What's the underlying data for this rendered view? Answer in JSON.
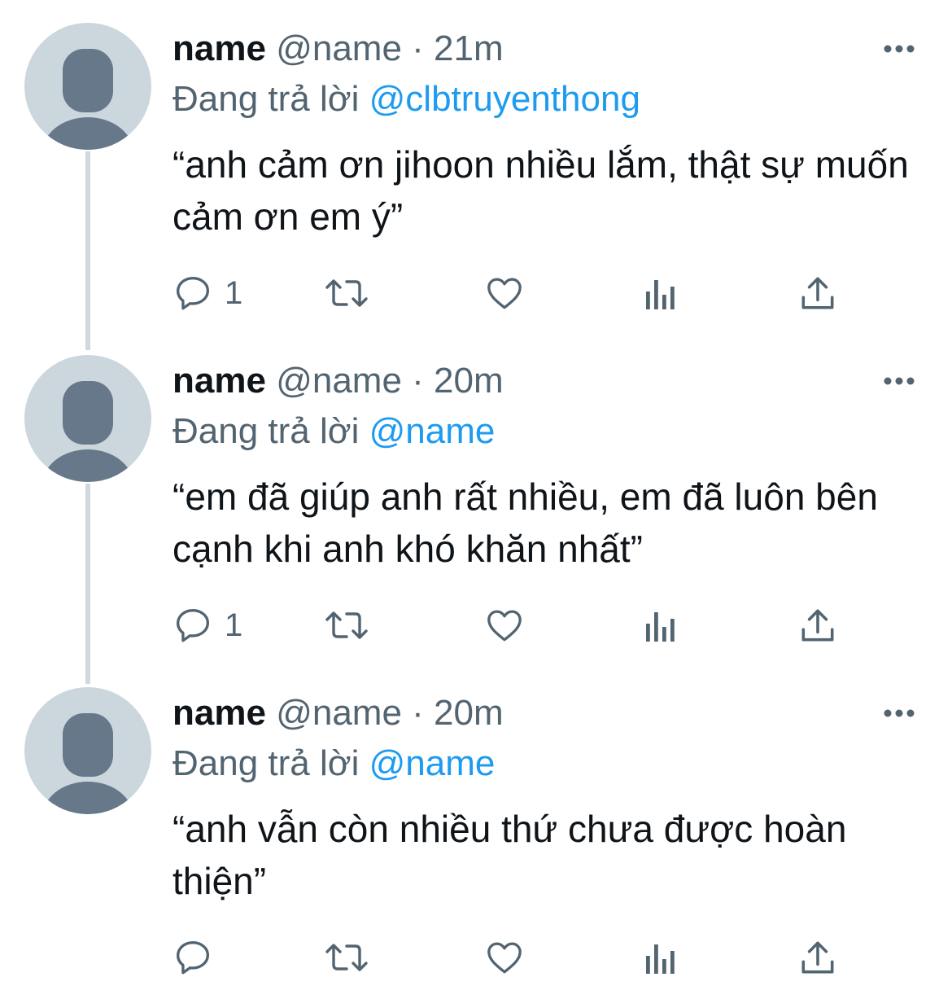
{
  "colors": {
    "text": "#0f1419",
    "secondary": "#536471",
    "link": "#1d9bf0",
    "avatar_bg": "#ccd6dd",
    "avatar_fg": "#66788a",
    "thread_line": "#cfd9de"
  },
  "icons": {
    "avatar": "default-profile-icon",
    "more": "more-dots-icon",
    "reply": "reply-bubble-icon",
    "retweet": "retweet-icon",
    "like": "heart-icon",
    "views": "analytics-bars-icon",
    "share": "share-upload-icon"
  },
  "tweets": [
    {
      "display_name": "name",
      "handle": "@name",
      "separator": "·",
      "time": "21m",
      "replying_prefix": "Đang trả lời",
      "replying_to": "@clbtruyenthong",
      "text": "“anh cảm ơn jihoon nhiều lắm, thật sự muốn cảm ơn em ý”",
      "reply_count": "1"
    },
    {
      "display_name": "name",
      "handle": "@name",
      "separator": "·",
      "time": "20m",
      "replying_prefix": "Đang trả lời",
      "replying_to": "@name",
      "text": "“em đã giúp anh rất nhiều, em đã luôn bên cạnh khi anh khó khăn nhất”",
      "reply_count": "1"
    },
    {
      "display_name": "name",
      "handle": "@name",
      "separator": "·",
      "time": "20m",
      "replying_prefix": "Đang trả lời",
      "replying_to": "@name",
      "text": "“anh vẫn còn nhiều thứ chưa được hoàn thiện”",
      "reply_count": ""
    }
  ]
}
